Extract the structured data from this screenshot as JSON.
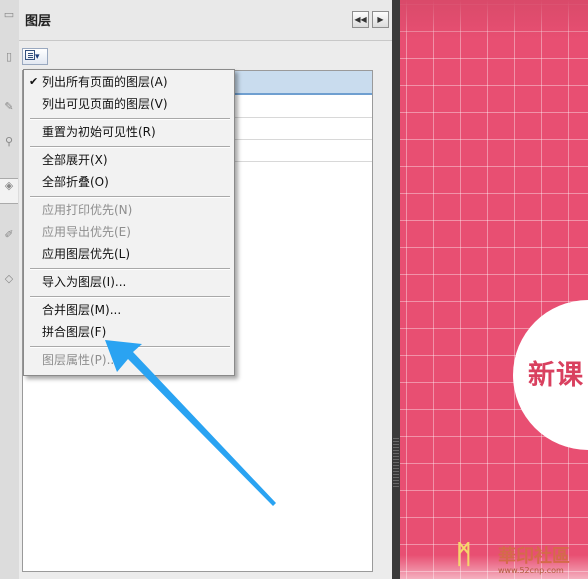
{
  "panel": {
    "title": "图层"
  },
  "menu": {
    "items": [
      {
        "label": "列出所有页面的图层(A)",
        "checked": true,
        "enabled": true
      },
      {
        "label": "列出可见页面的图层(V)",
        "checked": false,
        "enabled": true
      },
      {
        "label": "重置为初始可见性(R)",
        "checked": false,
        "enabled": true
      },
      {
        "label": "全部展开(X)",
        "checked": false,
        "enabled": true
      },
      {
        "label": "全部折叠(O)",
        "checked": false,
        "enabled": true
      },
      {
        "label": "应用打印优先(N)",
        "checked": false,
        "enabled": false
      },
      {
        "label": "应用导出优先(E)",
        "checked": false,
        "enabled": false
      },
      {
        "label": "应用图层优先(L)",
        "checked": false,
        "enabled": true
      },
      {
        "label": "导入为图层(I)...",
        "checked": false,
        "enabled": true
      },
      {
        "label": "合并图层(M)...",
        "checked": false,
        "enabled": true
      },
      {
        "label": "拼合图层(F)",
        "checked": false,
        "enabled": true
      },
      {
        "label": "图层属性(P)...",
        "checked": false,
        "enabled": false
      }
    ],
    "check_glyph": "✔"
  },
  "document": {
    "circle_text": "新课",
    "watermark": {
      "title": "華印社區",
      "url": "www.52cnp.com"
    },
    "colors": {
      "background": "#e84f72",
      "accent_text": "#d9405f"
    }
  },
  "annotation": {
    "arrow_color": "#2aa3f2",
    "points_to": "拼合图层(F)"
  }
}
